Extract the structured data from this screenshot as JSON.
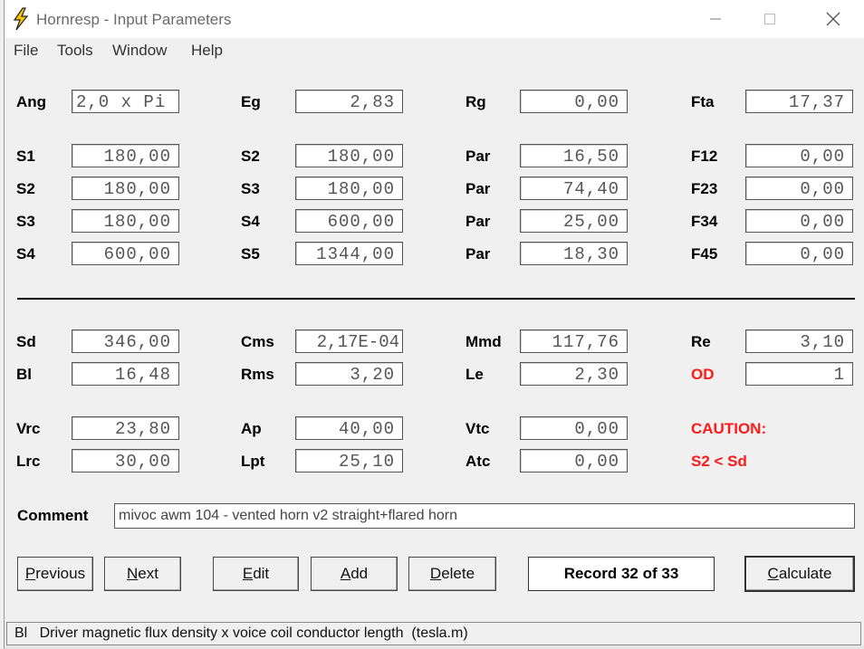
{
  "window": {
    "title": "Hornresp - Input Parameters"
  },
  "menu": [
    "File",
    "Tools",
    "Window",
    "Help"
  ],
  "params": {
    "ang": {
      "label": "Ang",
      "value": "2,0 x Pi"
    },
    "eg": {
      "label": "Eg",
      "value": "2,83"
    },
    "rg": {
      "label": "Rg",
      "value": "0,00"
    },
    "fta": {
      "label": "Fta",
      "value": "17,37"
    },
    "r1": [
      {
        "label": "S1",
        "value": "180,00"
      },
      {
        "label": "S2",
        "value": "180,00"
      },
      {
        "label": "Par",
        "value": "16,50"
      },
      {
        "label": "F12",
        "value": "0,00"
      }
    ],
    "r2": [
      {
        "label": "S2",
        "value": "180,00"
      },
      {
        "label": "S3",
        "value": "180,00"
      },
      {
        "label": "Par",
        "value": "74,40"
      },
      {
        "label": "F23",
        "value": "0,00"
      }
    ],
    "r3": [
      {
        "label": "S3",
        "value": "180,00"
      },
      {
        "label": "S4",
        "value": "600,00"
      },
      {
        "label": "Par",
        "value": "25,00"
      },
      {
        "label": "F34",
        "value": "0,00"
      }
    ],
    "r4": [
      {
        "label": "S4",
        "value": "600,00"
      },
      {
        "label": "S5",
        "value": "1344,00"
      },
      {
        "label": "Par",
        "value": "18,30"
      },
      {
        "label": "F45",
        "value": "0,00"
      }
    ]
  },
  "driver": {
    "r1": [
      {
        "label": "Sd",
        "value": "346,00"
      },
      {
        "label": "Cms",
        "value": "2,17E-04"
      },
      {
        "label": "Mmd",
        "value": "117,76"
      },
      {
        "label": "Re",
        "value": "3,10"
      }
    ],
    "r2": [
      {
        "label": "Bl",
        "value": "16,48"
      },
      {
        "label": "Rms",
        "value": "3,20"
      },
      {
        "label": "Le",
        "value": "2,30"
      },
      {
        "label": "OD",
        "value": "1"
      }
    ],
    "r3": [
      {
        "label": "Vrc",
        "value": "23,80"
      },
      {
        "label": "Ap",
        "value": "40,00"
      },
      {
        "label": "Vtc",
        "value": "0,00"
      }
    ],
    "r4": [
      {
        "label": "Lrc",
        "value": "30,00"
      },
      {
        "label": "Lpt",
        "value": "25,10"
      },
      {
        "label": "Atc",
        "value": "0,00"
      }
    ],
    "caution_title": "CAUTION:",
    "caution_msg": "S2 < Sd"
  },
  "comment": {
    "label": "Comment",
    "value": "mivoc awm 104 - vented horn v2 straight+flared horn"
  },
  "buttons": {
    "previous": {
      "u": "P",
      "rest": "revious"
    },
    "next": {
      "u": "N",
      "rest": "ext"
    },
    "edit": {
      "u": "E",
      "rest": "dit"
    },
    "add": {
      "u": "A",
      "rest": "dd"
    },
    "delete": {
      "u": "D",
      "rest": "elete"
    },
    "calculate": {
      "u": "C",
      "rest": "alculate"
    }
  },
  "record": "Record 32 of 33",
  "status": "Bl   Driver magnetic flux density x voice coil conductor length  (tesla.m)",
  "colors": {
    "caution": "#ff1a1a",
    "icon_bolt": "#f5c400"
  }
}
